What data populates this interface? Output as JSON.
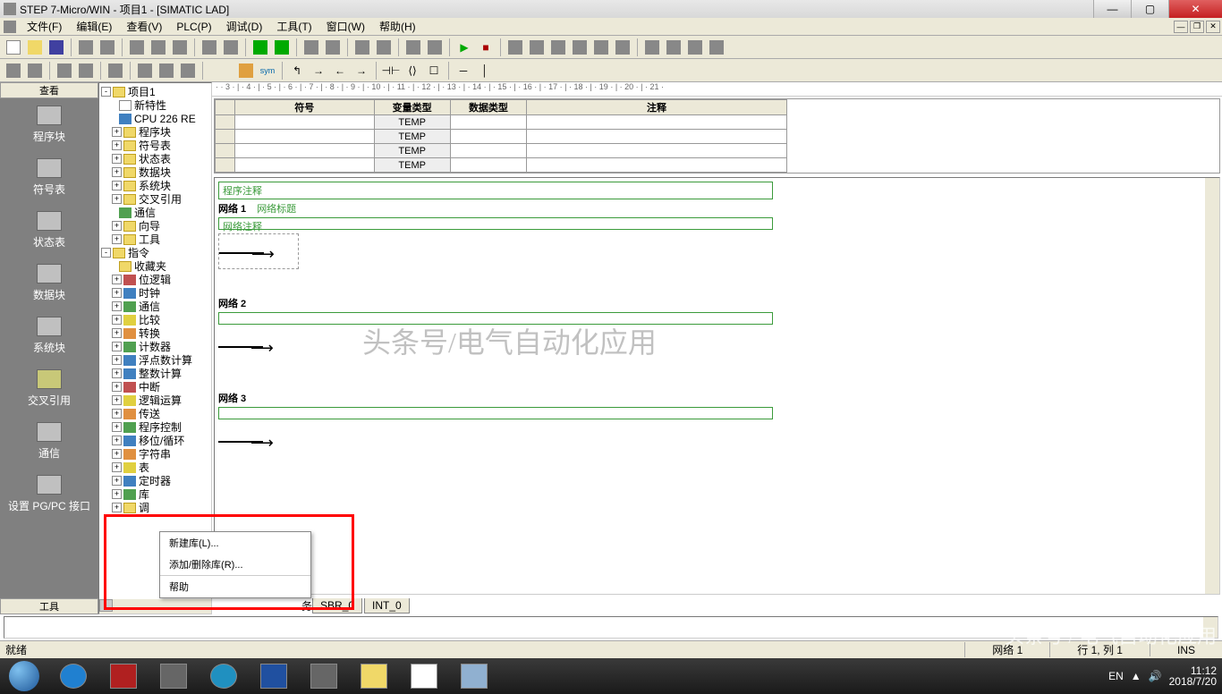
{
  "titlebar": {
    "text": "STEP 7-Micro/WIN - 项目1 - [SIMATIC LAD]"
  },
  "menu": {
    "file": "文件(F)",
    "edit": "编辑(E)",
    "view": "查看(V)",
    "plc": "PLC(P)",
    "debug": "调试(D)",
    "tools": "工具(T)",
    "window": "窗口(W)",
    "help": "帮助(H)"
  },
  "sidebar": {
    "header": "查看",
    "items": [
      {
        "label": "程序块"
      },
      {
        "label": "符号表"
      },
      {
        "label": "状态表"
      },
      {
        "label": "数据块"
      },
      {
        "label": "系统块"
      },
      {
        "label": "交叉引用"
      },
      {
        "label": "通信"
      },
      {
        "label": "设置 PG/PC 接口"
      }
    ],
    "footer": "工具"
  },
  "tree": {
    "root": "项目1",
    "items": [
      "新特性",
      "CPU 226 RE",
      "程序块",
      "符号表",
      "状态表",
      "数据块",
      "系统块",
      "交叉引用",
      "通信",
      "向导",
      "工具"
    ],
    "folder": "指令",
    "instructions": [
      "收藏夹",
      "位逻辑",
      "时钟",
      "通信",
      "比较",
      "转换",
      "计数器",
      "浮点数计算",
      "整数计算",
      "中断",
      "逻辑运算",
      "传送",
      "程序控制",
      "移位/循环",
      "字符串",
      "表",
      "定时器"
    ]
  },
  "vartable": {
    "headers": {
      "symbol": "符号",
      "vartype": "变量类型",
      "datatype": "数据类型",
      "comment": "注释"
    },
    "rows": [
      {
        "type": "TEMP"
      },
      {
        "type": "TEMP"
      },
      {
        "type": "TEMP"
      },
      {
        "type": "TEMP"
      }
    ]
  },
  "ladder": {
    "prog_comment": "程序注释",
    "networks": [
      {
        "label": "网络 1",
        "title": "网络标题",
        "comment": "网络注释",
        "boxed": true
      },
      {
        "label": "网络 2",
        "boxed": false
      },
      {
        "label": "网络 3",
        "boxed": false
      }
    ]
  },
  "context_menu": {
    "items": [
      {
        "label": "新建库(L)..."
      },
      {
        "label": "添加/删除库(R)..."
      },
      {
        "label": "帮助"
      }
    ]
  },
  "tabs": {
    "sbr": "SBR_0",
    "int": "INT_0",
    "prefix": "务"
  },
  "statusbar": {
    "ready": "就绪",
    "net": "网络 1",
    "pos": "行 1, 列 1",
    "ins": "INS"
  },
  "tray": {
    "ime": "EN",
    "time": "11:12",
    "date": "2018/7/20"
  },
  "watermark": {
    "main": "头条号/电气自动化应用",
    "corner": "头条号 / 电气自动化应用"
  },
  "ruler_text": "· · 3 · | · 4 · | · 5 · | · 6 · | · 7 · | · 8 · | · 9 · | · 10 · | · 11 · | · 12 · | · 13 · | · 14 · | · 15 · | · 16 · | · 17 · | · 18 · | · 19 · | · 20 · | · 21 ·"
}
